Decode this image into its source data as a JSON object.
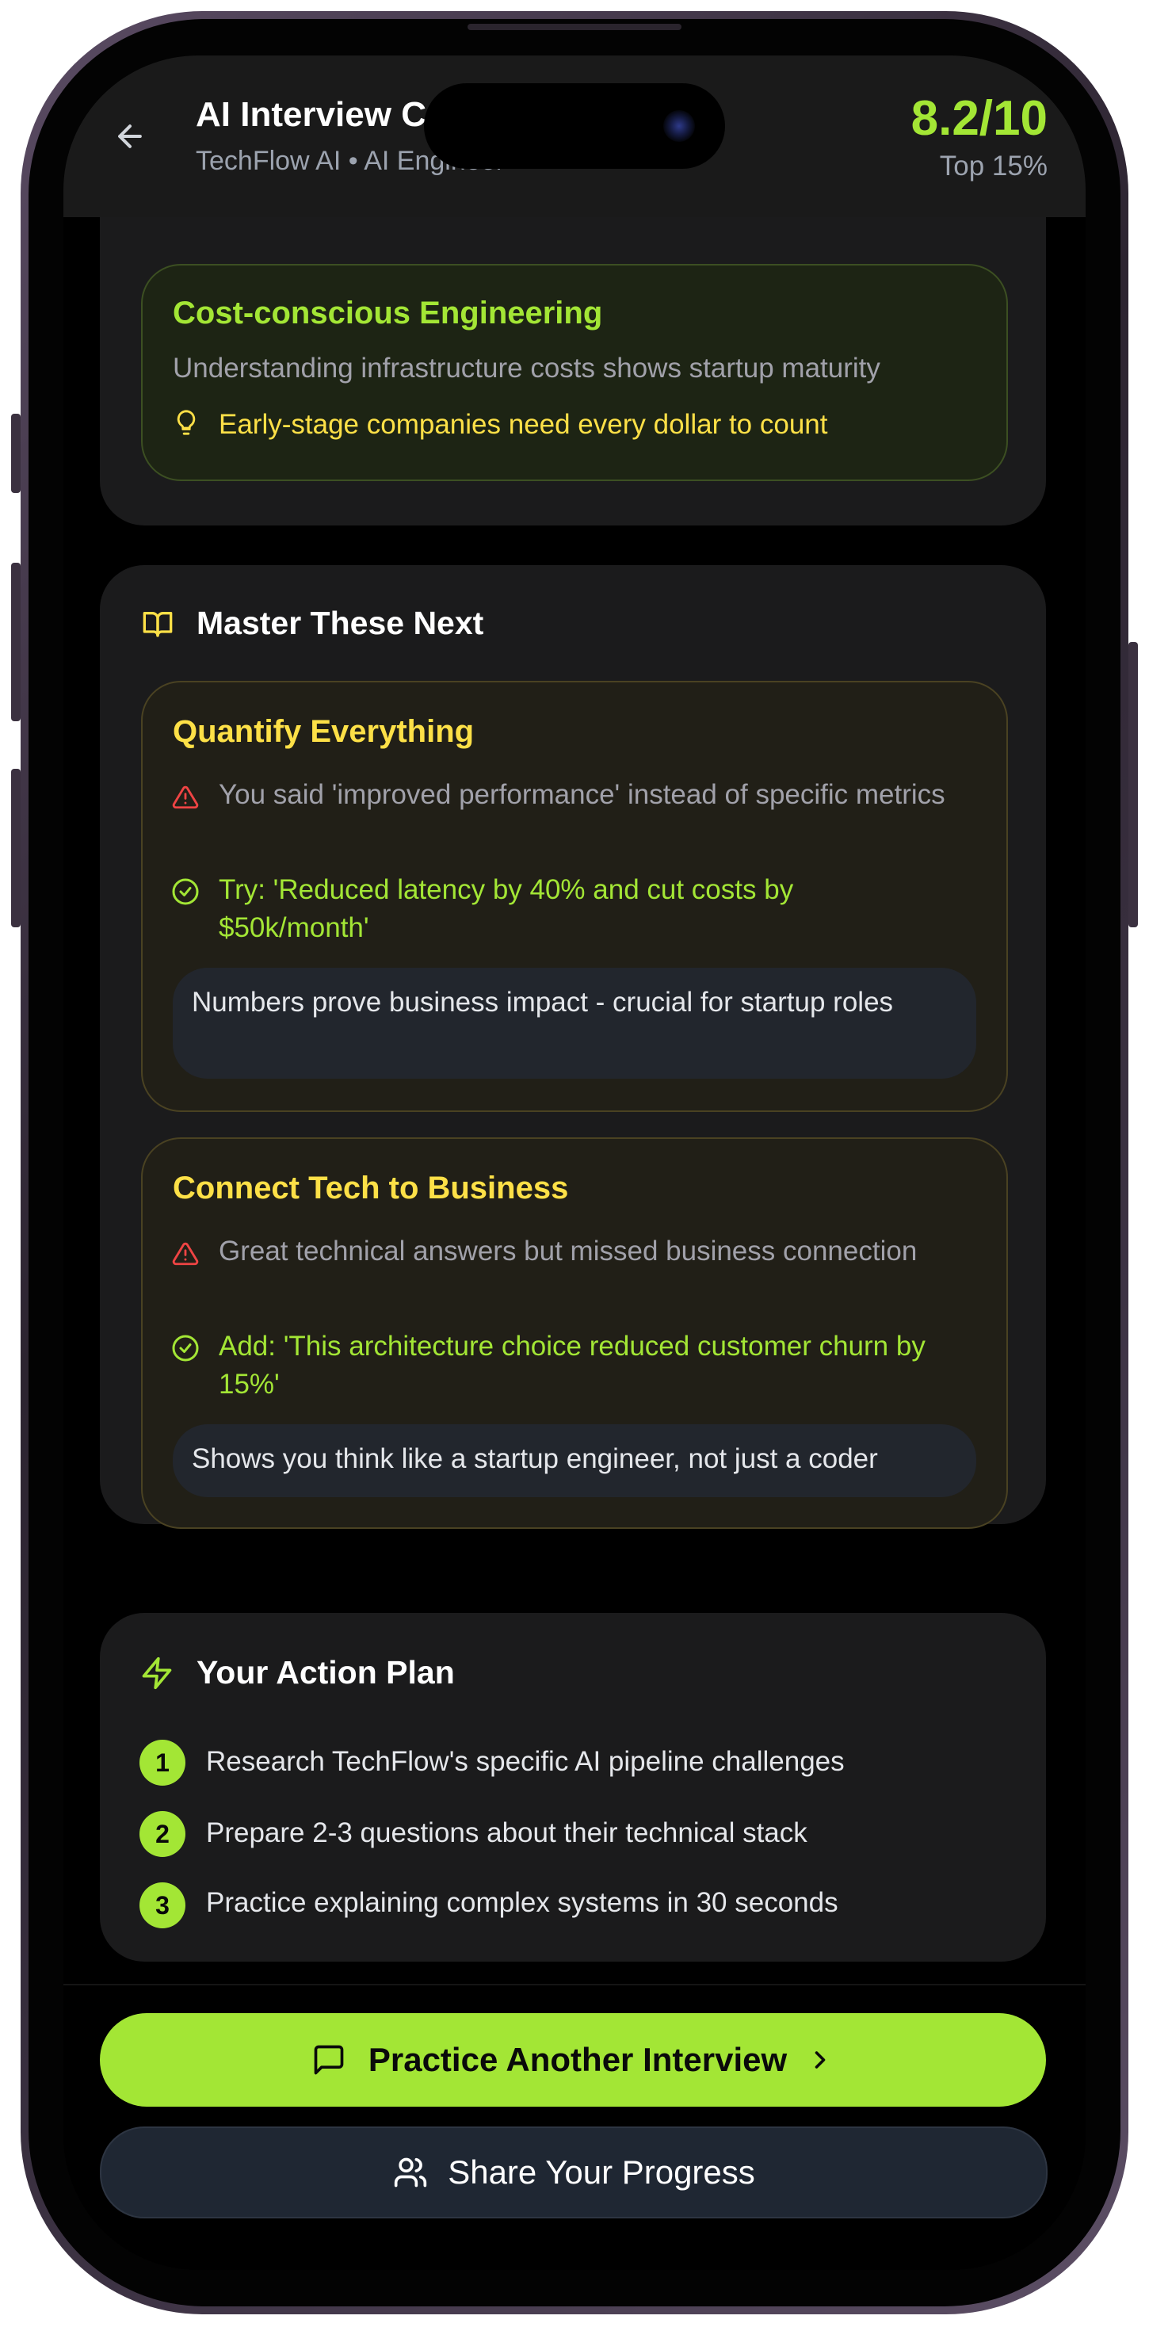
{
  "header": {
    "title": "AI Interview Coach",
    "subtitle": "TechFlow AI • AI Engineer",
    "score": "8.2/10",
    "rank": "Top 15%"
  },
  "strengths": {
    "item": {
      "title": "Cost-conscious Engineering",
      "description": "Understanding infrastructure costs shows startup maturity",
      "tip": "Early-stage companies need every dollar to count"
    }
  },
  "master_next": {
    "heading": "Master These Next",
    "items": [
      {
        "title": "Quantify Everything",
        "issue": "You said 'improved performance' instead of specific metrics",
        "suggestion": "Try: 'Reduced latency by 40% and cut costs by $50k/month'",
        "note": "Numbers prove business impact - crucial for startup roles"
      },
      {
        "title": "Connect Tech to Business",
        "issue": "Great technical answers but missed business connection",
        "suggestion": "Add: 'This architecture choice reduced customer churn by 15%'",
        "note": "Shows you think like a startup engineer, not just a coder"
      }
    ]
  },
  "action_plan": {
    "heading": "Your Action Plan",
    "steps": [
      {
        "num": "1",
        "text": "Research TechFlow's specific AI pipeline challenges"
      },
      {
        "num": "2",
        "text": "Prepare 2-3 questions about their technical stack"
      },
      {
        "num": "3",
        "text": "Practice explaining complex systems in 30 seconds"
      }
    ]
  },
  "buttons": {
    "primary": "Practice Another Interview",
    "secondary": "Share Your Progress"
  },
  "colors": {
    "accent": "#a3e635",
    "warning": "#fde047",
    "error": "#ef4444",
    "background": "#000000",
    "card": "#1b1b1c"
  },
  "icons": {
    "back": "arrow-left-icon",
    "tip": "lightbulb-icon",
    "book": "book-open-icon",
    "issue": "alert-triangle-icon",
    "fix": "check-circle-icon",
    "action": "zap-icon",
    "chat": "message-square-icon",
    "chevron": "chevron-right-icon",
    "users": "users-icon"
  }
}
